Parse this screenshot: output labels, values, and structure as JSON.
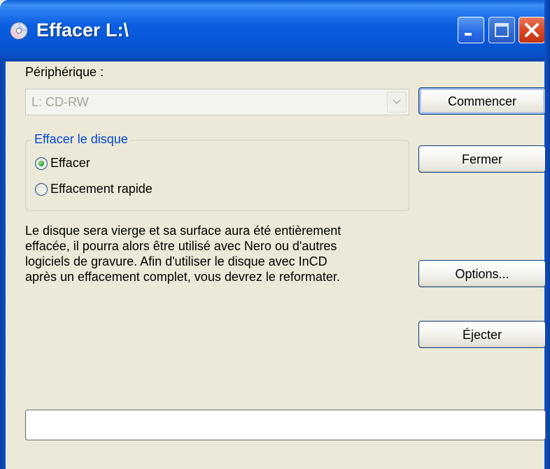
{
  "window": {
    "title": "Effacer L:\\",
    "icon": "cd-disc-icon",
    "controls": [
      "minimize-icon",
      "maximize-icon",
      "close-icon"
    ]
  },
  "device": {
    "label": "Périphérique :",
    "selected": "L: CD-RW",
    "enabled": false
  },
  "erase_group": {
    "title": "Effacer le disque",
    "options": [
      {
        "label": "Effacer",
        "selected": true
      },
      {
        "label": "Effacement rapide",
        "selected": false
      }
    ]
  },
  "description": {
    "lines": [
      "Le disque sera vierge et sa surface aura été entièrement",
      "effacée, il pourra alors être utilisé avec Nero ou d'autres",
      "logiciels de gravure. Afin d'utiliser le disque avec InCD",
      "après un effacement complet, vous devrez le reformater."
    ]
  },
  "buttons": {
    "start": "Commencer",
    "close": "Fermer",
    "options": "Options...",
    "eject": "Éjecter"
  },
  "progress": {
    "value": 0
  },
  "colors": {
    "titlebar": "#0a5fd8",
    "dialog_bg": "#ece9d8",
    "group_title": "#0046d5",
    "close_button": "#d8441e",
    "disabled_text": "#a8a597"
  }
}
